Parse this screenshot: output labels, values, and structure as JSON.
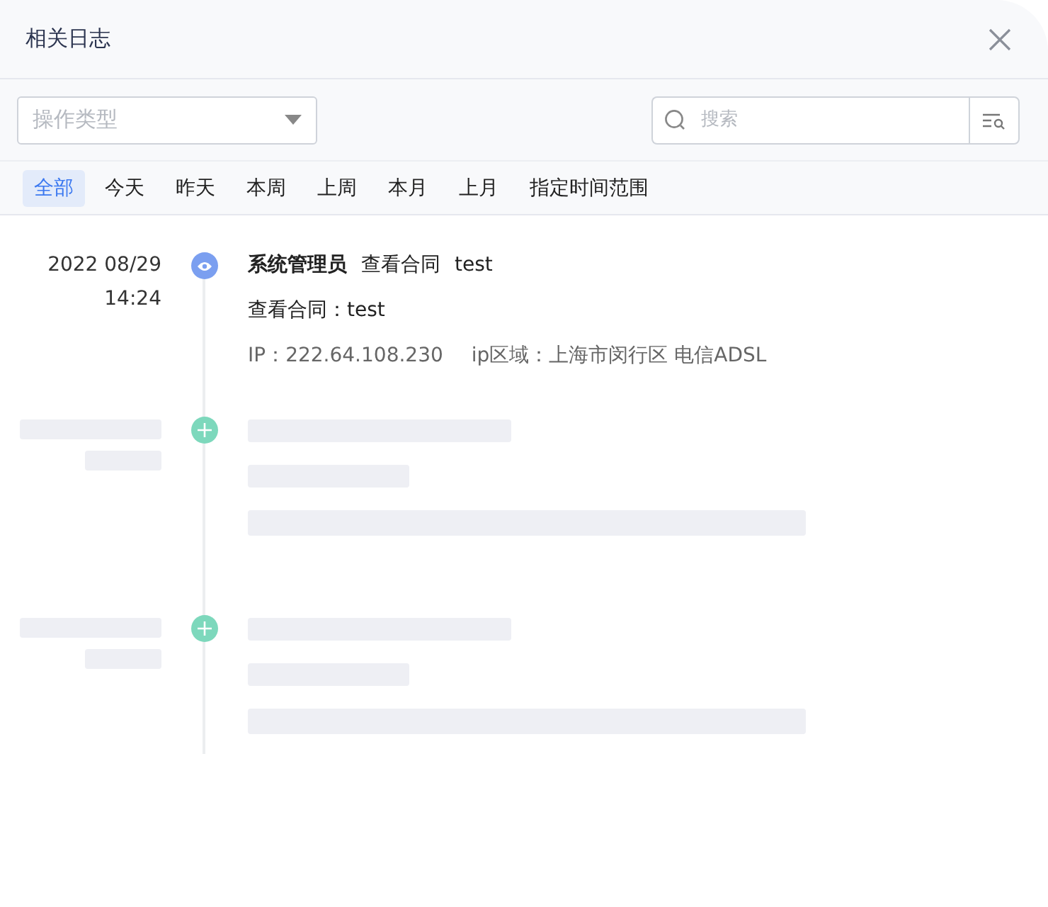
{
  "dialog": {
    "title": "相关日志"
  },
  "filters": {
    "type_select": {
      "placeholder": "操作类型"
    },
    "search": {
      "placeholder": "搜索"
    }
  },
  "ranges": [
    {
      "label": "全部",
      "selected": true
    },
    {
      "label": "今天",
      "selected": false
    },
    {
      "label": "昨天",
      "selected": false
    },
    {
      "label": "本周",
      "selected": false
    },
    {
      "label": "上周",
      "selected": false
    },
    {
      "label": "本月",
      "selected": false
    },
    {
      "label": "上月",
      "selected": false
    },
    {
      "label": "指定时间范围",
      "selected": false
    }
  ],
  "entries": [
    {
      "kind": "event",
      "color": "#7b9ff0",
      "date": "2022 08/29",
      "time": "14:24",
      "user": "系统管理员",
      "action": "查看合同",
      "target": "test",
      "detail": "查看合同：test",
      "ip": "IP：222.64.108.230",
      "region": "ip区域：上海市闵行区 电信ADSL"
    },
    {
      "kind": "skeleton",
      "color": "#7dd8bc"
    },
    {
      "kind": "skeleton",
      "color": "#7dd8bc"
    }
  ]
}
